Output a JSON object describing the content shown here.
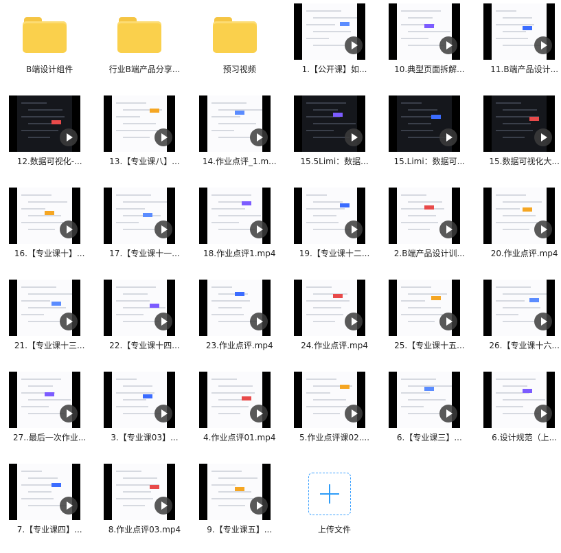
{
  "items": [
    {
      "type": "folder",
      "label": "B端设计组件"
    },
    {
      "type": "folder",
      "label": "行业B端产品分享..."
    },
    {
      "type": "folder",
      "label": "预习视频"
    },
    {
      "type": "video",
      "label": "1.【公开课】如...",
      "style": "light"
    },
    {
      "type": "video",
      "label": "10.典型页面拆解...",
      "style": "light"
    },
    {
      "type": "video",
      "label": "11.B端产品设计...",
      "style": "light"
    },
    {
      "type": "video",
      "label": "12.数据可视化-...",
      "style": "dark"
    },
    {
      "type": "video",
      "label": "13.【专业课八】...",
      "style": "light"
    },
    {
      "type": "video",
      "label": "14.作业点评_1.m...",
      "style": "light"
    },
    {
      "type": "video",
      "label": "15.5Limi：数据...",
      "style": "dark"
    },
    {
      "type": "video",
      "label": "15.Limi：数据可...",
      "style": "dark"
    },
    {
      "type": "video",
      "label": "15.数据可视化大...",
      "style": "dark"
    },
    {
      "type": "video",
      "label": "16.【专业课十】...",
      "style": "light"
    },
    {
      "type": "video",
      "label": "17.【专业课十一...",
      "style": "light"
    },
    {
      "type": "video",
      "label": "18.作业点评1.mp4",
      "style": "light"
    },
    {
      "type": "video",
      "label": "19.【专业课十二...",
      "style": "light"
    },
    {
      "type": "video",
      "label": "2.B端产品设计训...",
      "style": "light"
    },
    {
      "type": "video",
      "label": "20.作业点评.mp4",
      "style": "light"
    },
    {
      "type": "video",
      "label": "21.【专业课十三...",
      "style": "light"
    },
    {
      "type": "video",
      "label": "22.【专业课十四...",
      "style": "light"
    },
    {
      "type": "video",
      "label": "23.作业点评.mp4",
      "style": "light"
    },
    {
      "type": "video",
      "label": "24.作业点评.mp4",
      "style": "light"
    },
    {
      "type": "video",
      "label": "25.【专业课十五...",
      "style": "light"
    },
    {
      "type": "video",
      "label": "26.【专业课十六...",
      "style": "light"
    },
    {
      "type": "video",
      "label": "27..最后一次作业...",
      "style": "light"
    },
    {
      "type": "video",
      "label": "3.【专业课03】...",
      "style": "light"
    },
    {
      "type": "video",
      "label": "4.作业点评01.mp4",
      "style": "light"
    },
    {
      "type": "video",
      "label": "5.作业点评课02....",
      "style": "light"
    },
    {
      "type": "video",
      "label": "6.【专业课三】...",
      "style": "light"
    },
    {
      "type": "video",
      "label": "6.设计规范（上...",
      "style": "light"
    },
    {
      "type": "video",
      "label": "7.【专业课四】...",
      "style": "light"
    },
    {
      "type": "video",
      "label": "8.作业点评03.mp4",
      "style": "light"
    },
    {
      "type": "video",
      "label": "9.【专业课五】...",
      "style": "light"
    },
    {
      "type": "upload",
      "label": "上传文件"
    }
  ],
  "colors": {
    "folder": "#fad04c",
    "upload": "#2d9cf8"
  }
}
